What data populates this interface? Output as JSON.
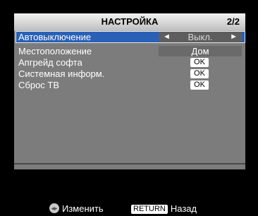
{
  "header": {
    "title": "НАСТРОЙКА",
    "page": "2/2"
  },
  "menu": {
    "items": [
      {
        "label": "Автовыключение",
        "value": "Выкл.",
        "left_arrow": "◄",
        "right_arrow": "►"
      },
      {
        "label": "Местоположение",
        "value": "Дом"
      },
      {
        "label": "Апгрейд софта",
        "value": "OK"
      },
      {
        "label": "Системная информ.",
        "value": "OK"
      },
      {
        "label": "Сброс ТВ",
        "value": "OK"
      }
    ]
  },
  "footer": {
    "change_label": "Изменить",
    "return_key": "RETURN",
    "back_label": "Назад"
  },
  "colors": {
    "selection": "#2a61b7",
    "panel": "#7c7c7c",
    "background": "#000000"
  }
}
